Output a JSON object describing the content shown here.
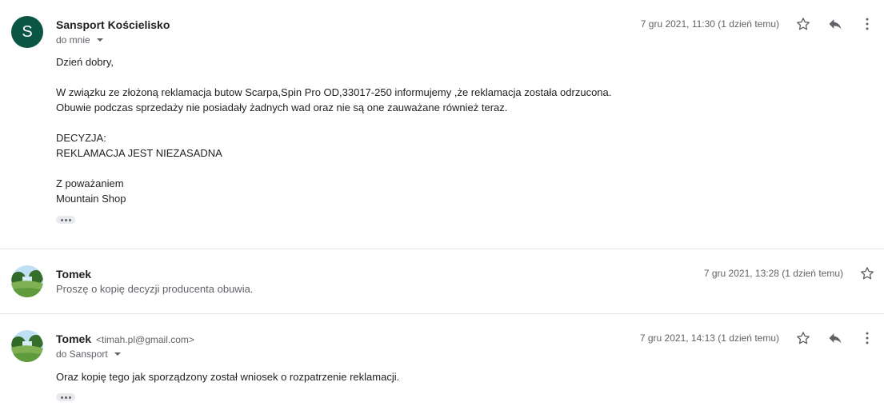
{
  "messages": [
    {
      "avatar_letter": "S",
      "sender": "Sansport Kościelisko",
      "to_line": "do mnie",
      "date": "7 gru 2021, 11:30 (1 dzień temu)",
      "body": [
        "Dzień dobry,",
        "W związku ze złożoną reklamacja butow Scarpa,Spin Pro OD,33017-250 informujemy ,że reklamacja została odrzucona.",
        "Obuwie podczas sprzedaży nie posiadały żadnych wad oraz nie są one zauważane również teraz.",
        "DECYZJA:",
        "REKLAMACJA JEST NIEZASADNA",
        "Z poważaniem",
        "Mountain Shop"
      ]
    },
    {
      "sender": "Tomek",
      "snippet": "Proszę o kopię decyzji producenta obuwia.",
      "date": "7 gru 2021, 13:28 (1 dzień temu)"
    },
    {
      "sender": "Tomek",
      "email": "<timah.pl@gmail.com>",
      "to_line": "do Sansport",
      "date": "7 gru 2021, 14:13 (1 dzień temu)",
      "body": [
        "Oraz kopię tego jak sporządzony został wniosek o rozpatrzenie reklamacji."
      ]
    }
  ],
  "colors": {
    "avatar_bg": "#0b5545",
    "icon": "#5f6368",
    "divider": "#e4e4e4"
  },
  "icons": [
    "star-icon",
    "reply-icon",
    "more-vert-icon",
    "show-trimmed-content-icon",
    "caret-down-icon"
  ]
}
